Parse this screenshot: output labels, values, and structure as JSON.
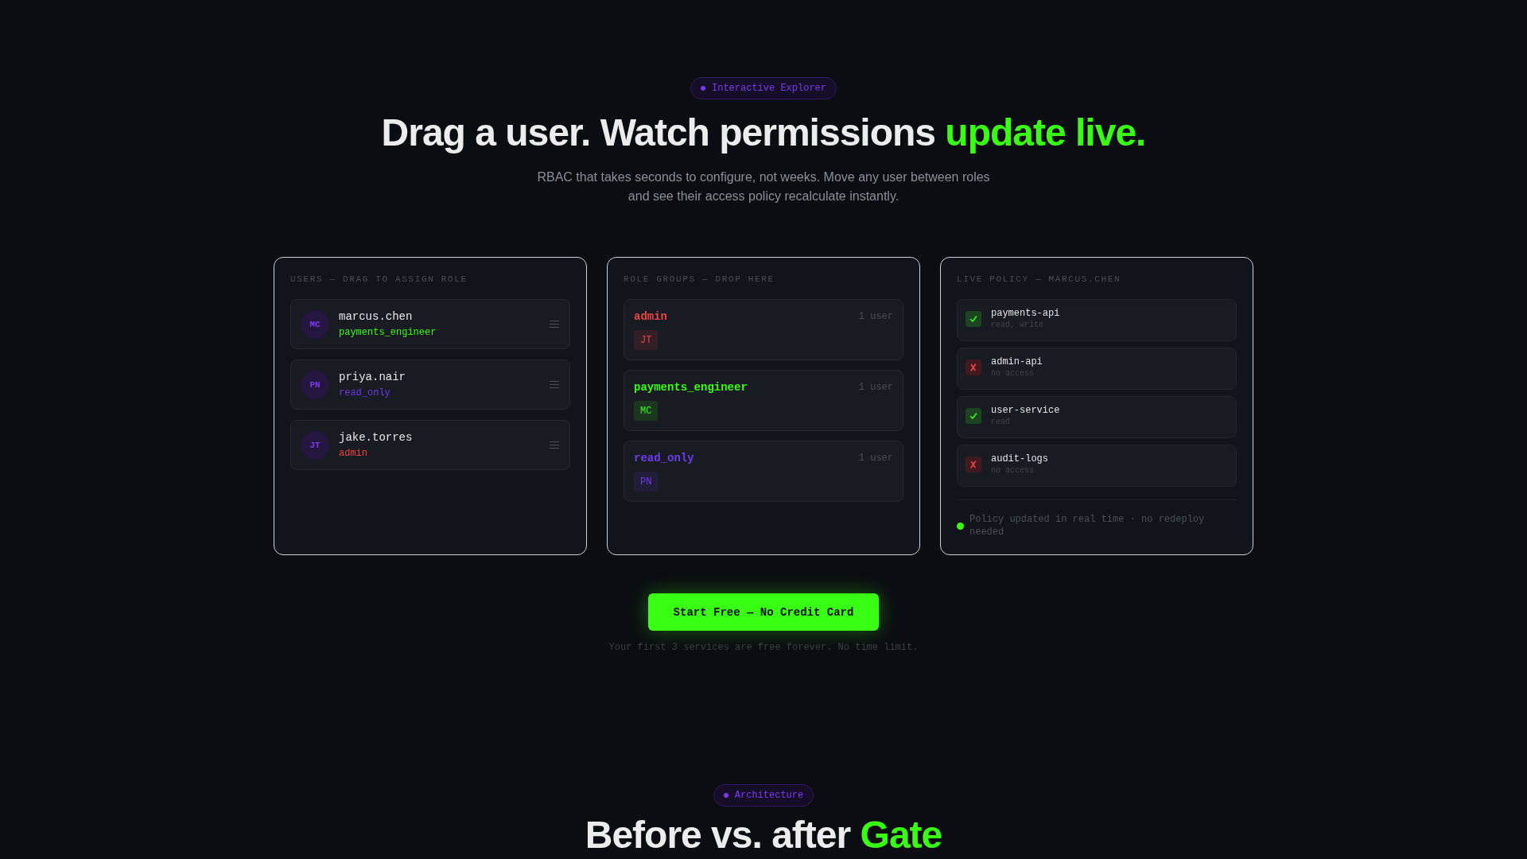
{
  "hero": {
    "badge": "Interactive Explorer",
    "title": {
      "lead": "Drag a user. Watch permissions",
      "highlight": "update live."
    },
    "subtitle": "RBAC that takes seconds to configure, not weeks. Move any user between roles and see their access policy recalculate instantly."
  },
  "users_panel": {
    "heading": "USERS — DRAG TO ASSIGN ROLE",
    "users": [
      {
        "initials": "MC",
        "name": "marcus.chen",
        "role": "payments_engineer",
        "color": "#39ff14"
      },
      {
        "initials": "PN",
        "name": "priya.nair",
        "role": "read_only",
        "color": "#6d3aed"
      },
      {
        "initials": "JT",
        "name": "jake.torres",
        "role": "admin",
        "color": "#ef4444"
      }
    ]
  },
  "roles_panel": {
    "heading": "ROLE GROUPS — DROP HERE",
    "roles": [
      {
        "name": "admin",
        "count": "1 user",
        "color": "#ef4444",
        "members": [
          "JT"
        ]
      },
      {
        "name": "payments_engineer",
        "count": "1 user",
        "color": "#39ff14",
        "members": [
          "MC"
        ]
      },
      {
        "name": "read_only",
        "count": "1 user",
        "color": "#6d3aed",
        "members": [
          "PN"
        ]
      }
    ]
  },
  "policy_panel": {
    "heading": "LIVE POLICY — MARCUS.CHEN",
    "items": [
      {
        "service": "payments-api",
        "access": "read, write",
        "granted": true
      },
      {
        "service": "admin-api",
        "access": "no access",
        "granted": false
      },
      {
        "service": "user-service",
        "access": "read",
        "granted": true
      },
      {
        "service": "audit-logs",
        "access": "no access",
        "granted": false
      }
    ],
    "footer": "Policy updated in real time · no redeploy needed"
  },
  "cta": {
    "button": "Start Free — No Credit Card",
    "note": "Your first 3 services are free forever. No time limit."
  },
  "next_section": {
    "badge": "Architecture",
    "title": {
      "lead": "Before vs. after",
      "highlight": "Gate"
    }
  }
}
